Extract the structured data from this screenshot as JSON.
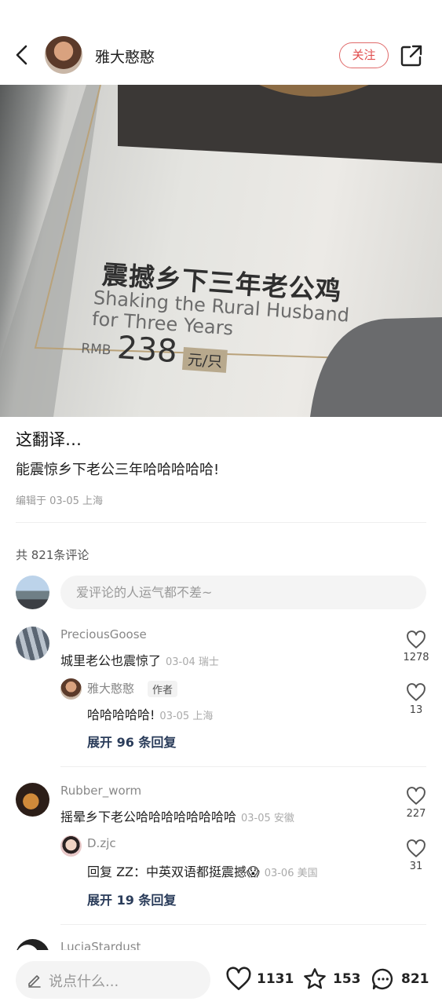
{
  "header": {
    "author_name": "雅大憨憨",
    "follow_label": "关注"
  },
  "photo": {
    "dish_cn": "震撼乡下三年老公鸡",
    "dish_en_line1": "Shaking the Rural Husband",
    "dish_en_line2": "for Three Years",
    "currency": "RMB",
    "price": "238",
    "unit": "元/只"
  },
  "post": {
    "title": "这翻译…",
    "body": "能震惊乡下老公三年哈哈哈哈哈!",
    "meta": "编辑于 03-05 上海"
  },
  "comments_section": {
    "count_label": "共 821条评论",
    "input_placeholder": "爱评论的人运气都不差~"
  },
  "comments": [
    {
      "user": "PreciousGoose",
      "text": "城里老公也震惊了",
      "meta": "03-04 瑞士",
      "likes": "1278",
      "reply": {
        "user": "雅大憨憨",
        "tag": "作者",
        "text": "哈哈哈哈哈!",
        "meta": "03-05 上海",
        "likes": "13"
      },
      "expand_label": "展开 96 条回复"
    },
    {
      "user": "Rubber_worm",
      "text": "摇晕乡下老公哈哈哈哈哈哈哈哈",
      "meta": "03-05 安徽",
      "likes": "227",
      "reply": {
        "user": "D.zjc",
        "text": "回复 ZZ：中英双语都挺震撼",
        "emoji": "😱",
        "meta": "03-06 美国",
        "likes": "31"
      },
      "expand_label": "展开 19 条回复"
    },
    {
      "user": "LuciaStardust"
    }
  ],
  "bottom_bar": {
    "input_placeholder": "说点什么...",
    "likes": "1131",
    "stars": "153",
    "comments": "821"
  },
  "colors": {
    "accent_red": "#e04b4b",
    "expand_blue": "#2a3c5a"
  },
  "icons": [
    "back-arrow-icon",
    "share-icon",
    "heart-icon",
    "star-icon",
    "comment-icon",
    "pencil-icon"
  ]
}
